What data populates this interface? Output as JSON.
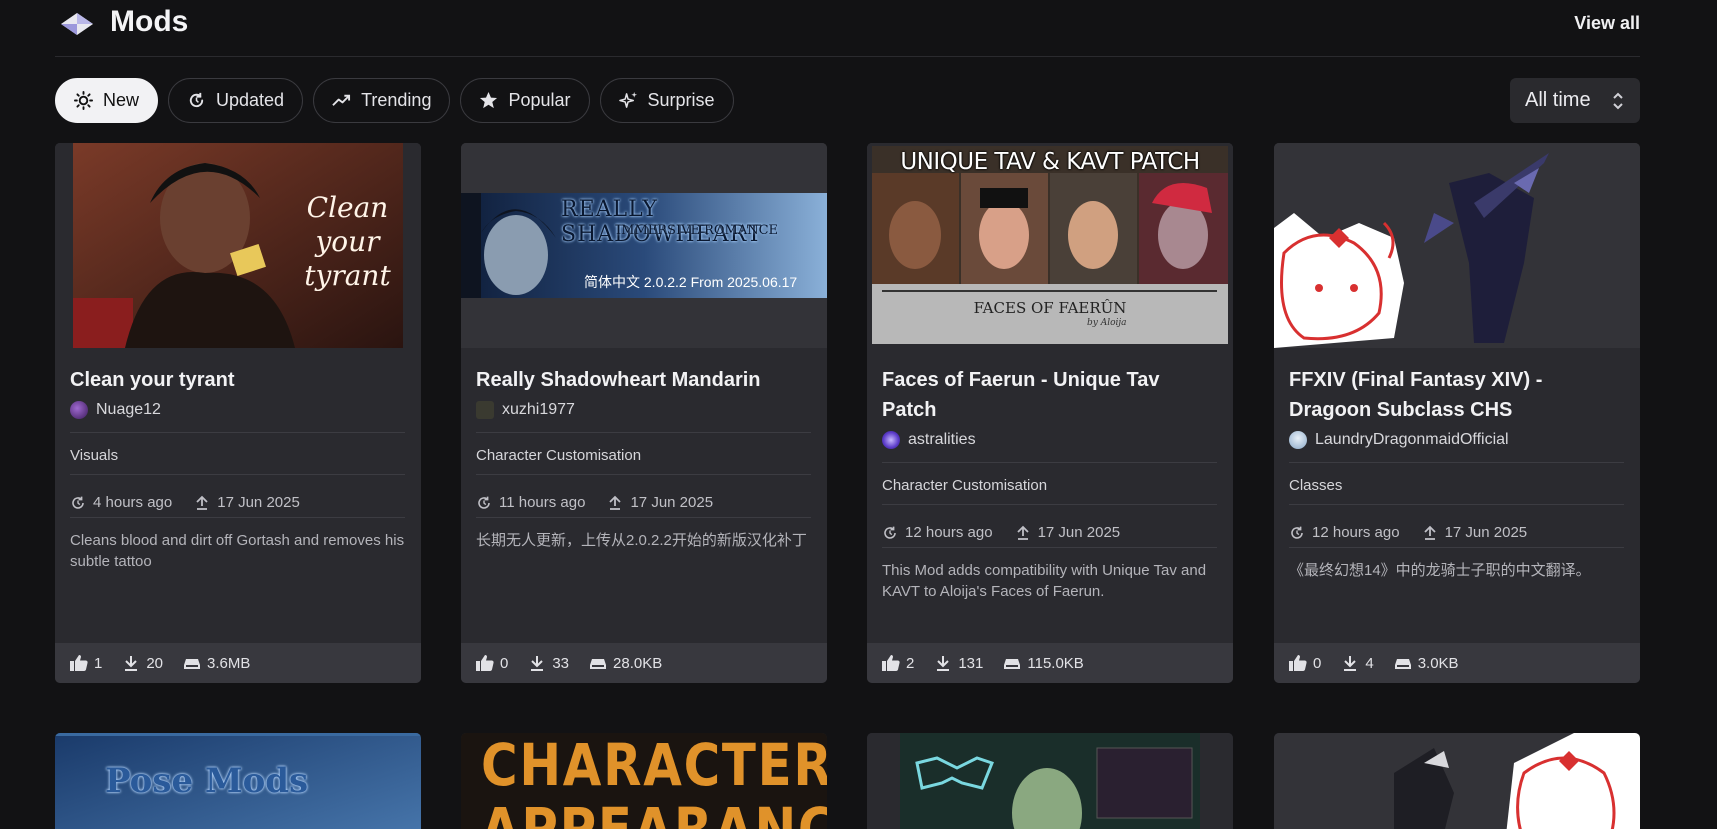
{
  "header": {
    "title": "Mods",
    "view_all": "View all"
  },
  "tabs": [
    {
      "label": "New",
      "icon": "sun-icon",
      "active": true
    },
    {
      "label": "Updated",
      "icon": "refresh-icon"
    },
    {
      "label": "Trending",
      "icon": "trending-icon"
    },
    {
      "label": "Popular",
      "icon": "star-icon"
    },
    {
      "label": "Surprise",
      "icon": "sparkles-icon"
    }
  ],
  "sort": {
    "value": "All time"
  },
  "cards": [
    {
      "title": "Clean your tyrant",
      "thumb_text": "Clean your tyrant",
      "author": "Nuage12",
      "category": "Visuals",
      "updated": "4 hours ago",
      "uploaded": "17 Jun 2025",
      "description": "Cleans blood and dirt off Gortash and removes his subtle tattoo",
      "likes": "1",
      "downloads": "20",
      "size": "3.6MB"
    },
    {
      "title": "Really Shadowheart Mandarin",
      "thumb_text": "REALLY SHADOWHEART",
      "thumb_sub": "IMMERSIVE ROMANCE",
      "thumb_caption": "简体中文 2.0.2.2 From 2025.06.17",
      "author": "xuzhi1977",
      "category": "Character Customisation",
      "updated": "11 hours ago",
      "uploaded": "17 Jun 2025",
      "description": "长期无人更新，上传从2.0.2.2开始的新版汉化补丁",
      "likes": "0",
      "downloads": "33",
      "size": "28.0KB"
    },
    {
      "title": "Faces of Faerun - Unique Tav Patch",
      "thumb_text": "UNIQUE TAV & KAVT PATCH",
      "thumb_sub": "FACES OF FAERÛN",
      "thumb_caption": "by Aloija",
      "author": "astralities",
      "category": "Character Customisation",
      "updated": "12 hours ago",
      "uploaded": "17 Jun 2025",
      "description": "This Mod adds compatibility with Unique Tav and KAVT to Aloija's Faces of Faerun.",
      "likes": "2",
      "downloads": "131",
      "size": "115.0KB"
    },
    {
      "title": "FFXIV (Final Fantasy XIV) - Dragoon Subclass CHS",
      "author": "LaundryDragonmaidOfficial",
      "category": "Classes",
      "updated": "12 hours ago",
      "uploaded": "17 Jun 2025",
      "description": "《最终幻想14》中的龙骑士子职的中文翻译。",
      "likes": "0",
      "downloads": "4",
      "size": "3.0KB"
    }
  ],
  "second_row": [
    {
      "thumb_text": "Pose Mods"
    },
    {
      "thumb_text": "CHARACTER APPEARANCE"
    },
    {
      "thumb_text": ""
    },
    {
      "thumb_text": ""
    }
  ],
  "colors": {
    "background": "#121214",
    "card": "#2a2a2f",
    "card_footer": "#38383e",
    "active_tab": "#f2f2f4"
  }
}
